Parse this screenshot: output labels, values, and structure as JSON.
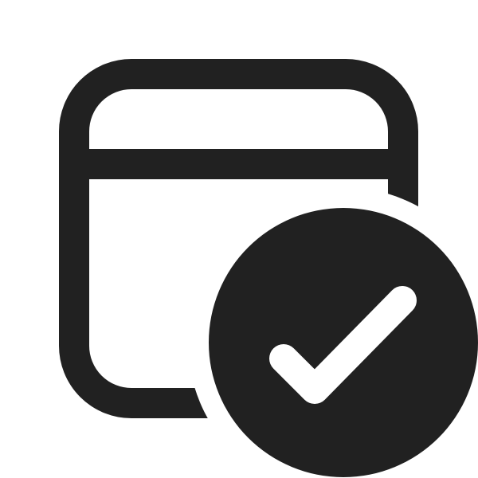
{
  "icon": {
    "name": "calendar-checkmark-icon",
    "color": "#212121",
    "background": "#ffffff",
    "badge_name": "checkmark-circle-icon",
    "checkmark_color": "#ffffff"
  }
}
